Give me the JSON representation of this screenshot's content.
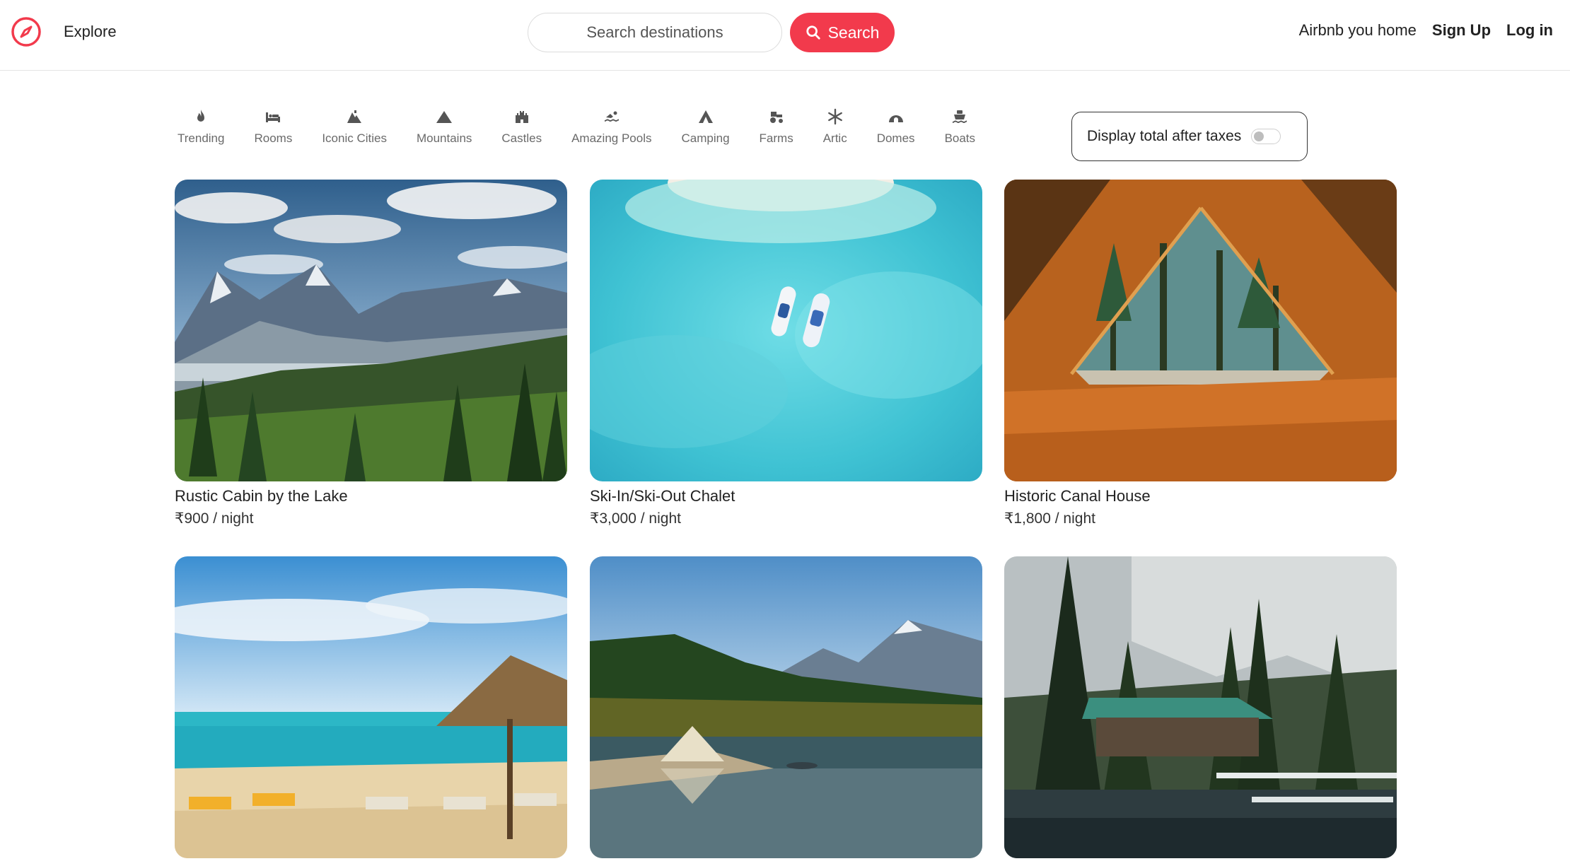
{
  "header": {
    "logo": "compass-icon",
    "explore_label": "Explore",
    "search_placeholder": "Search destinations",
    "search_button_label": "Search",
    "host_link": "Airbnb you home",
    "signup_label": "Sign Up",
    "login_label": "Log in",
    "brand_color": "#f23a4c"
  },
  "categories": [
    {
      "label": "Trending",
      "icon": "fire-icon"
    },
    {
      "label": "Rooms",
      "icon": "bed-icon"
    },
    {
      "label": "Iconic Cities",
      "icon": "city-icon"
    },
    {
      "label": "Mountains",
      "icon": "mountain-icon"
    },
    {
      "label": "Castles",
      "icon": "castle-icon"
    },
    {
      "label": "Amazing Pools",
      "icon": "swimmer-icon"
    },
    {
      "label": "Camping",
      "icon": "tent-icon"
    },
    {
      "label": "Farms",
      "icon": "tractor-icon"
    },
    {
      "label": "Artic",
      "icon": "snowflake-icon"
    },
    {
      "label": "Domes",
      "icon": "igloo-icon"
    },
    {
      "label": "Boats",
      "icon": "ship-icon"
    }
  ],
  "taxes_toggle": {
    "label": "Display total after taxes",
    "checked": false
  },
  "listings": [
    {
      "title": "Rustic Cabin by the Lake",
      "price": "₹900 / night",
      "image": "mountain-valley-photo"
    },
    {
      "title": "Ski-In/Ski-Out Chalet",
      "price": "₹3,000 / night",
      "image": "turquoise-sea-boats-photo"
    },
    {
      "title": "Historic Canal House",
      "price": "₹1,800 / night",
      "image": "tent-forest-view-photo"
    },
    {
      "title": "",
      "price": "",
      "image": "tropical-beach-photo"
    },
    {
      "title": "",
      "price": "",
      "image": "lake-tent-photo"
    },
    {
      "title": "",
      "price": "",
      "image": "forest-cabin-photo"
    }
  ]
}
